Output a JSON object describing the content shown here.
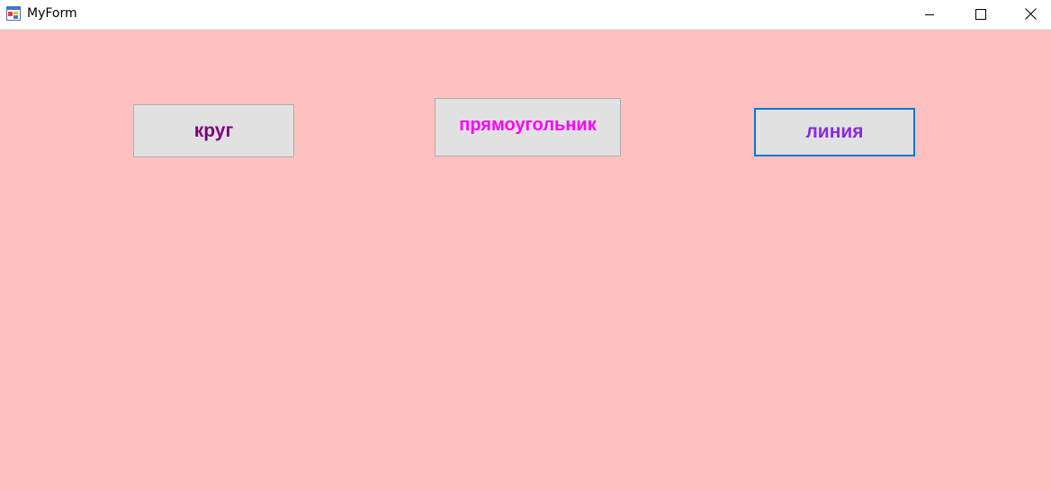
{
  "window": {
    "title": "MyForm",
    "app_icon": "winforms-app-icon",
    "controls": {
      "minimize_icon": "minimize-icon",
      "maximize_icon": "maximize-icon",
      "close_icon": "close-icon"
    }
  },
  "colors": {
    "client_background": "#ffc0c0",
    "button_face": "#e1e1e1",
    "focus_border": "#0078d7"
  },
  "buttons": [
    {
      "label": "круг",
      "color": "#800080"
    },
    {
      "label": "прямоугольник",
      "color": "#ff00ff"
    },
    {
      "label": "линия",
      "color": "#8a2be2",
      "focused": true
    }
  ]
}
